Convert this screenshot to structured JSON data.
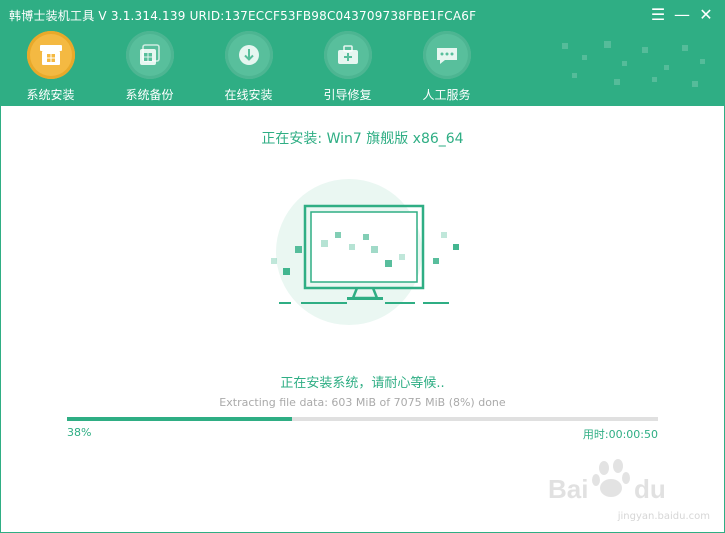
{
  "app": {
    "title": "韩博士装机工具 V 3.1.314.139 URID:137ECCF53FB98C043709738FBE1FCA6F"
  },
  "window_controls": {
    "menu": "☰",
    "minimize": "—",
    "close": "✕"
  },
  "tabs": [
    {
      "label": "系统安装",
      "icon": "system-install-icon",
      "active": true
    },
    {
      "label": "系统备份",
      "icon": "system-backup-icon",
      "active": false
    },
    {
      "label": "在线安装",
      "icon": "online-install-icon",
      "active": false
    },
    {
      "label": "引导修复",
      "icon": "boot-repair-icon",
      "active": false
    },
    {
      "label": "人工服务",
      "icon": "chat-service-icon",
      "active": false
    }
  ],
  "install": {
    "title": "正在安装: Win7 旗舰版 x86_64",
    "status": "正在安装系统，请耐心等候..",
    "detail": "Extracting file data: 603 MiB of 7075 MiB (8%) done",
    "progress_percent": 38,
    "progress_label": "38%",
    "elapsed": "用时:00:00:50"
  },
  "watermark": {
    "text": "jingyan.baidu.com"
  },
  "colors": {
    "accent": "#2fae84",
    "active_tab": "#f4b942"
  }
}
